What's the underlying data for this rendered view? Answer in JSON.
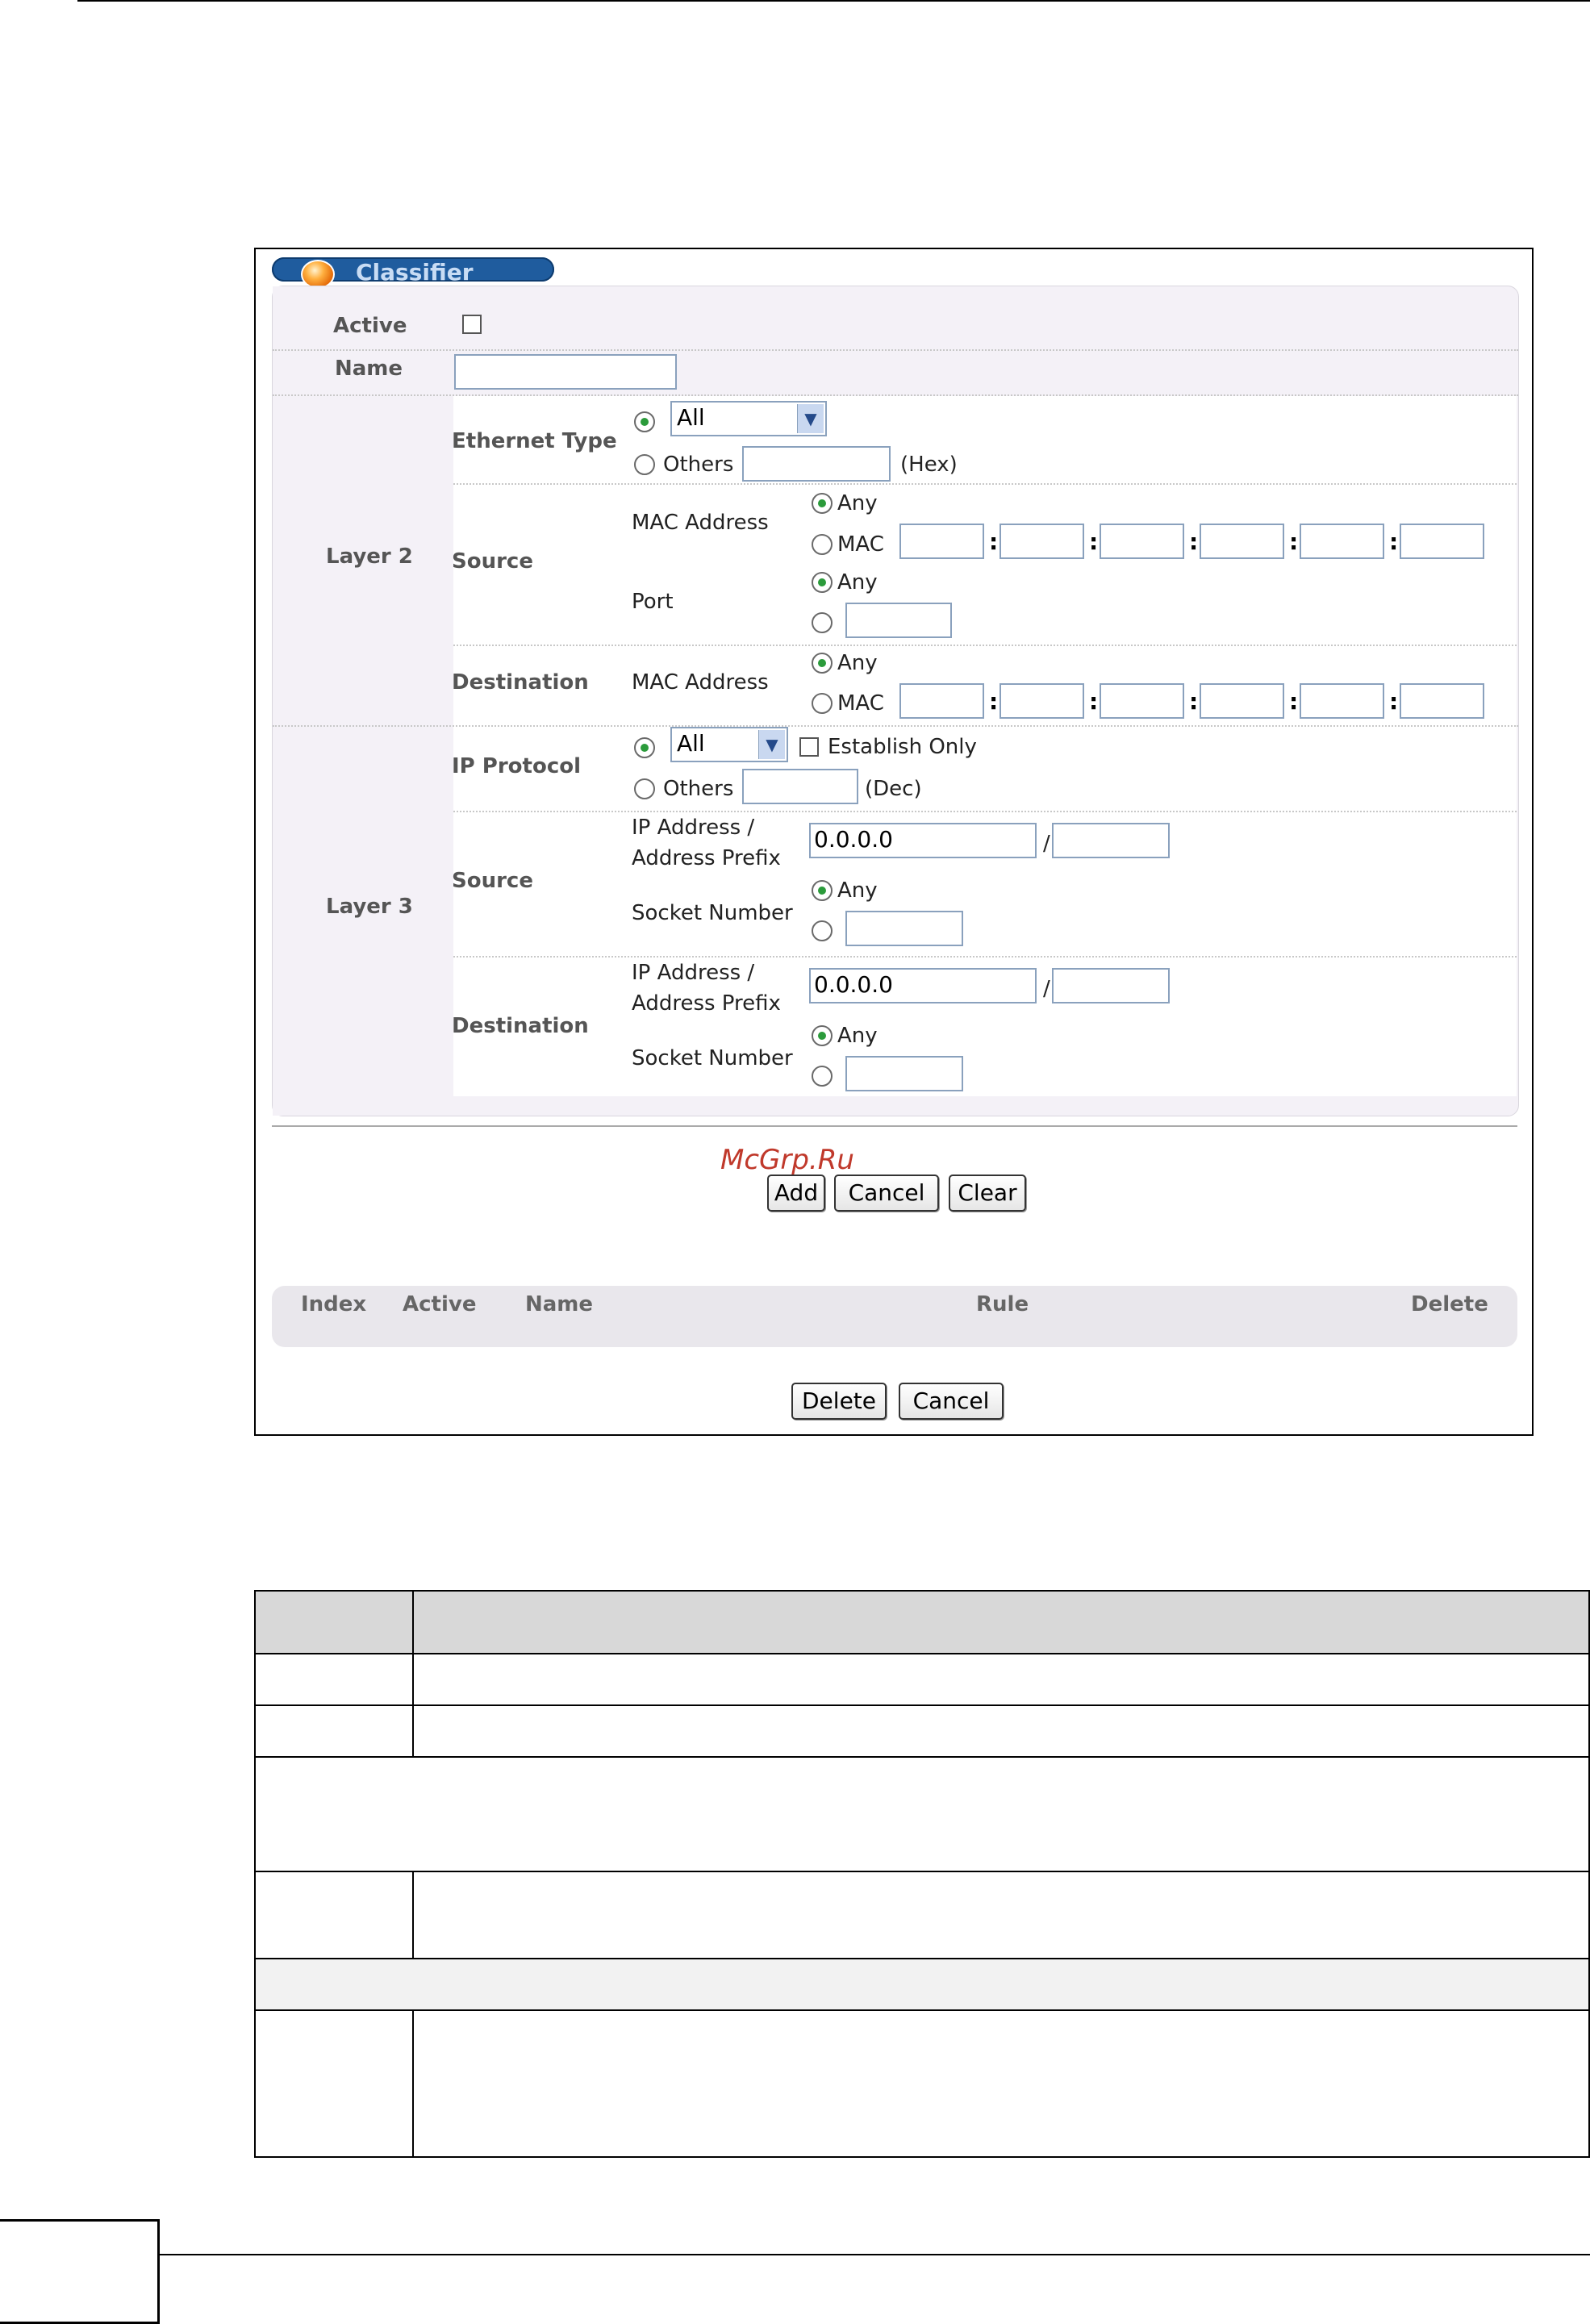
{
  "panel": {
    "title": "Classifier"
  },
  "form": {
    "active_label": "Active",
    "name_label": "Name",
    "layer2_label": "Layer 2",
    "ethernet_type_label": "Ethernet Type",
    "ethernet_type_select": "All",
    "others_label": "Others",
    "hex_label": "(Hex)",
    "source_label": "Source",
    "mac_address_label": "MAC Address",
    "any_label": "Any",
    "mac_label": "MAC",
    "port_label": "Port",
    "destination_label": "Destination",
    "layer3_label": "Layer 3",
    "ip_protocol_label": "IP Protocol",
    "ip_protocol_select": "All",
    "establish_only_label": "Establish Only",
    "dec_label": "(Dec)",
    "ip_prefix_line1": "IP Address /",
    "ip_prefix_line2": "Address Prefix",
    "source_ip_value": "0.0.0.0",
    "dest_ip_value": "0.0.0.0",
    "slash": "/",
    "socket_number_label": "Socket Number"
  },
  "buttons": {
    "add": "Add",
    "cancel": "Cancel",
    "clear": "Clear",
    "delete": "Delete",
    "cancel2": "Cancel"
  },
  "list": {
    "headers": [
      "Index",
      "Active",
      "Name",
      "Rule",
      "Delete"
    ]
  },
  "watermark": "McGrp.Ru"
}
